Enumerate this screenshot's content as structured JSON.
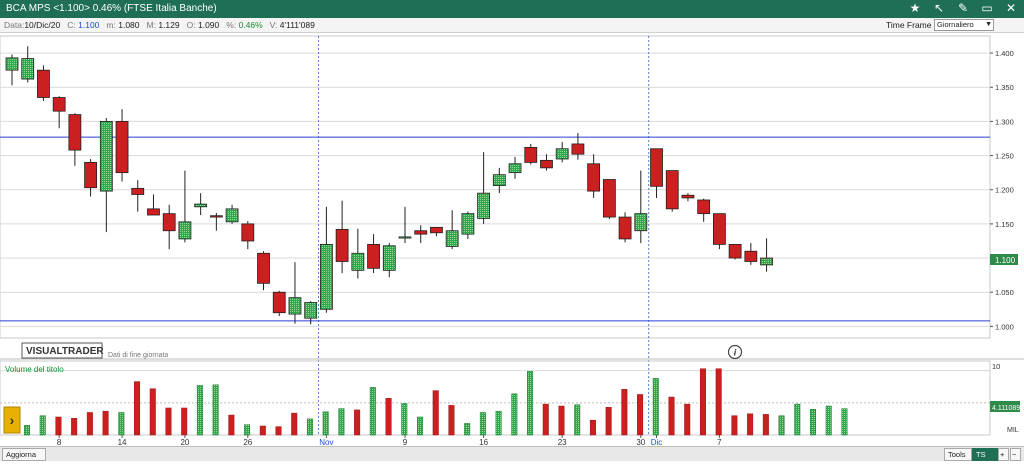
{
  "window": {
    "title": "BCA MPS <1.100> 0.46%  (FTSE Italia Banche)"
  },
  "toolbar_icons": [
    "star-icon",
    "pin-icon",
    "edit-icon",
    "maximize-icon",
    "close-icon"
  ],
  "info": {
    "date_label": "Data:",
    "date": "10/Dic/20",
    "close_label": "C:",
    "close": "1.100",
    "min_label": "m:",
    "min": "1.080",
    "max_label": "M:",
    "max": "1.129",
    "open_label": "O:",
    "open": "1.090",
    "pct_label": "%:",
    "pct": "0.46%",
    "vol_label": "V:",
    "vol": "4'111'089",
    "timeframe_label": "Time Frame",
    "timeframe_value": "Giornaliero"
  },
  "watermark": {
    "brand": "VISUALTRADER",
    "note": "Dati di fine giornata"
  },
  "price_badge": "1.100",
  "volume_panel": {
    "title": "Volume del titolo",
    "y_tick_top": "10",
    "y_unit": "MIL",
    "current_badge": "4.111089"
  },
  "bottom": {
    "update_button": "Aggiorna",
    "tools_button": "Tools",
    "tsoff_button": "TS OFF",
    "plus_button": "+",
    "minus_button": "−"
  },
  "colors": {
    "up": "#2ea84a",
    "down": "#cc1f1f",
    "hline": "#2b3fd6"
  },
  "chart_data": [
    {
      "type": "candlestick",
      "y_ticks": [
        "1.000",
        "1.050",
        "1.100",
        "1.150",
        "1.200",
        "1.250",
        "1.300",
        "1.350",
        "1.400"
      ],
      "ylim": [
        0.983,
        1.425
      ],
      "x_tick_labels": [
        {
          "label": "8",
          "index": 3
        },
        {
          "label": "14",
          "index": 7
        },
        {
          "label": "20",
          "index": 11
        },
        {
          "label": "26",
          "index": 15
        },
        {
          "label": "Nov",
          "index": 20
        },
        {
          "label": "9",
          "index": 25
        },
        {
          "label": "16",
          "index": 30
        },
        {
          "label": "23",
          "index": 35
        },
        {
          "label": "30",
          "index": 40
        },
        {
          "label": "Dic",
          "index": 41
        },
        {
          "label": "7",
          "index": 45
        }
      ],
      "month_separators": [
        20,
        41
      ],
      "horizontal_lines": [
        1.277,
        1.008
      ],
      "candles": [
        {
          "o": 1.375,
          "h": 1.398,
          "l": 1.353,
          "c": 1.393
        },
        {
          "o": 1.362,
          "h": 1.41,
          "l": 1.357,
          "c": 1.392
        },
        {
          "o": 1.375,
          "h": 1.382,
          "l": 1.33,
          "c": 1.335
        },
        {
          "o": 1.335,
          "h": 1.337,
          "l": 1.29,
          "c": 1.315
        },
        {
          "o": 1.31,
          "h": 1.312,
          "l": 1.235,
          "c": 1.258
        },
        {
          "o": 1.24,
          "h": 1.245,
          "l": 1.19,
          "c": 1.203
        },
        {
          "o": 1.198,
          "h": 1.305,
          "l": 1.138,
          "c": 1.3
        },
        {
          "o": 1.3,
          "h": 1.318,
          "l": 1.212,
          "c": 1.225
        },
        {
          "o": 1.202,
          "h": 1.214,
          "l": 1.168,
          "c": 1.193
        },
        {
          "o": 1.172,
          "h": 1.193,
          "l": 1.163,
          "c": 1.163
        },
        {
          "o": 1.165,
          "h": 1.178,
          "l": 1.113,
          "c": 1.14
        },
        {
          "o": 1.128,
          "h": 1.228,
          "l": 1.123,
          "c": 1.153
        },
        {
          "o": 1.175,
          "h": 1.195,
          "l": 1.163,
          "c": 1.179
        },
        {
          "o": 1.162,
          "h": 1.166,
          "l": 1.14,
          "c": 1.16
        },
        {
          "o": 1.153,
          "h": 1.178,
          "l": 1.15,
          "c": 1.172
        },
        {
          "o": 1.15,
          "h": 1.154,
          "l": 1.113,
          "c": 1.125
        },
        {
          "o": 1.107,
          "h": 1.11,
          "l": 1.053,
          "c": 1.063
        },
        {
          "o": 1.05,
          "h": 1.052,
          "l": 1.015,
          "c": 1.02
        },
        {
          "o": 1.018,
          "h": 1.094,
          "l": 1.004,
          "c": 1.042
        },
        {
          "o": 1.012,
          "h": 1.037,
          "l": 1.003,
          "c": 1.035
        },
        {
          "o": 1.025,
          "h": 1.175,
          "l": 1.02,
          "c": 1.12
        },
        {
          "o": 1.142,
          "h": 1.184,
          "l": 1.078,
          "c": 1.095
        },
        {
          "o": 1.082,
          "h": 1.143,
          "l": 1.07,
          "c": 1.107
        },
        {
          "o": 1.12,
          "h": 1.135,
          "l": 1.078,
          "c": 1.085
        },
        {
          "o": 1.082,
          "h": 1.122,
          "l": 1.072,
          "c": 1.118
        },
        {
          "o": 1.13,
          "h": 1.175,
          "l": 1.122,
          "c": 1.131
        },
        {
          "o": 1.14,
          "h": 1.148,
          "l": 1.122,
          "c": 1.135
        },
        {
          "o": 1.145,
          "h": 1.145,
          "l": 1.132,
          "c": 1.137
        },
        {
          "o": 1.117,
          "h": 1.17,
          "l": 1.113,
          "c": 1.14
        },
        {
          "o": 1.135,
          "h": 1.168,
          "l": 1.128,
          "c": 1.165
        },
        {
          "o": 1.158,
          "h": 1.255,
          "l": 1.15,
          "c": 1.195
        },
        {
          "o": 1.206,
          "h": 1.232,
          "l": 1.195,
          "c": 1.222
        },
        {
          "o": 1.225,
          "h": 1.248,
          "l": 1.216,
          "c": 1.238
        },
        {
          "o": 1.262,
          "h": 1.267,
          "l": 1.237,
          "c": 1.24
        },
        {
          "o": 1.243,
          "h": 1.252,
          "l": 1.228,
          "c": 1.232
        },
        {
          "o": 1.245,
          "h": 1.27,
          "l": 1.24,
          "c": 1.26
        },
        {
          "o": 1.267,
          "h": 1.283,
          "l": 1.244,
          "c": 1.252
        },
        {
          "o": 1.238,
          "h": 1.252,
          "l": 1.188,
          "c": 1.198
        },
        {
          "o": 1.215,
          "h": 1.215,
          "l": 1.157,
          "c": 1.16
        },
        {
          "o": 1.16,
          "h": 1.167,
          "l": 1.123,
          "c": 1.128
        },
        {
          "o": 1.14,
          "h": 1.228,
          "l": 1.122,
          "c": 1.165
        },
        {
          "o": 1.26,
          "h": 1.26,
          "l": 1.188,
          "c": 1.205
        },
        {
          "o": 1.228,
          "h": 1.228,
          "l": 1.168,
          "c": 1.172
        },
        {
          "o": 1.192,
          "h": 1.195,
          "l": 1.183,
          "c": 1.188
        },
        {
          "o": 1.185,
          "h": 1.187,
          "l": 1.153,
          "c": 1.165
        },
        {
          "o": 1.165,
          "h": 1.165,
          "l": 1.113,
          "c": 1.12
        },
        {
          "o": 1.12,
          "h": 1.12,
          "l": 1.098,
          "c": 1.1
        },
        {
          "o": 1.11,
          "h": 1.122,
          "l": 1.09,
          "c": 1.095
        },
        {
          "o": 1.09,
          "h": 1.129,
          "l": 1.08,
          "c": 1.1
        }
      ]
    },
    {
      "type": "bar",
      "title": "Volume del titolo",
      "ylim": [
        0,
        11.5
      ],
      "unit": "MIL",
      "values": [
        1.5,
        3.0,
        2.8,
        2.6,
        3.5,
        3.7,
        3.5,
        8.3,
        7.2,
        4.2,
        4.2,
        7.7,
        7.8,
        3.1,
        1.6,
        1.4,
        1.3,
        3.4,
        2.5,
        3.6,
        4.1,
        3.9,
        7.4,
        5.7,
        4.9,
        2.8,
        6.9,
        4.6,
        1.8,
        3.5,
        3.7,
        6.4,
        9.9,
        4.8,
        4.5,
        4.7,
        2.3,
        4.3,
        7.1,
        6.3,
        8.8,
        5.9,
        4.8,
        10.3,
        10.3,
        3.0,
        3.3,
        3.2,
        3.0,
        4.8,
        4.0,
        4.5,
        4.1
      ]
    }
  ]
}
